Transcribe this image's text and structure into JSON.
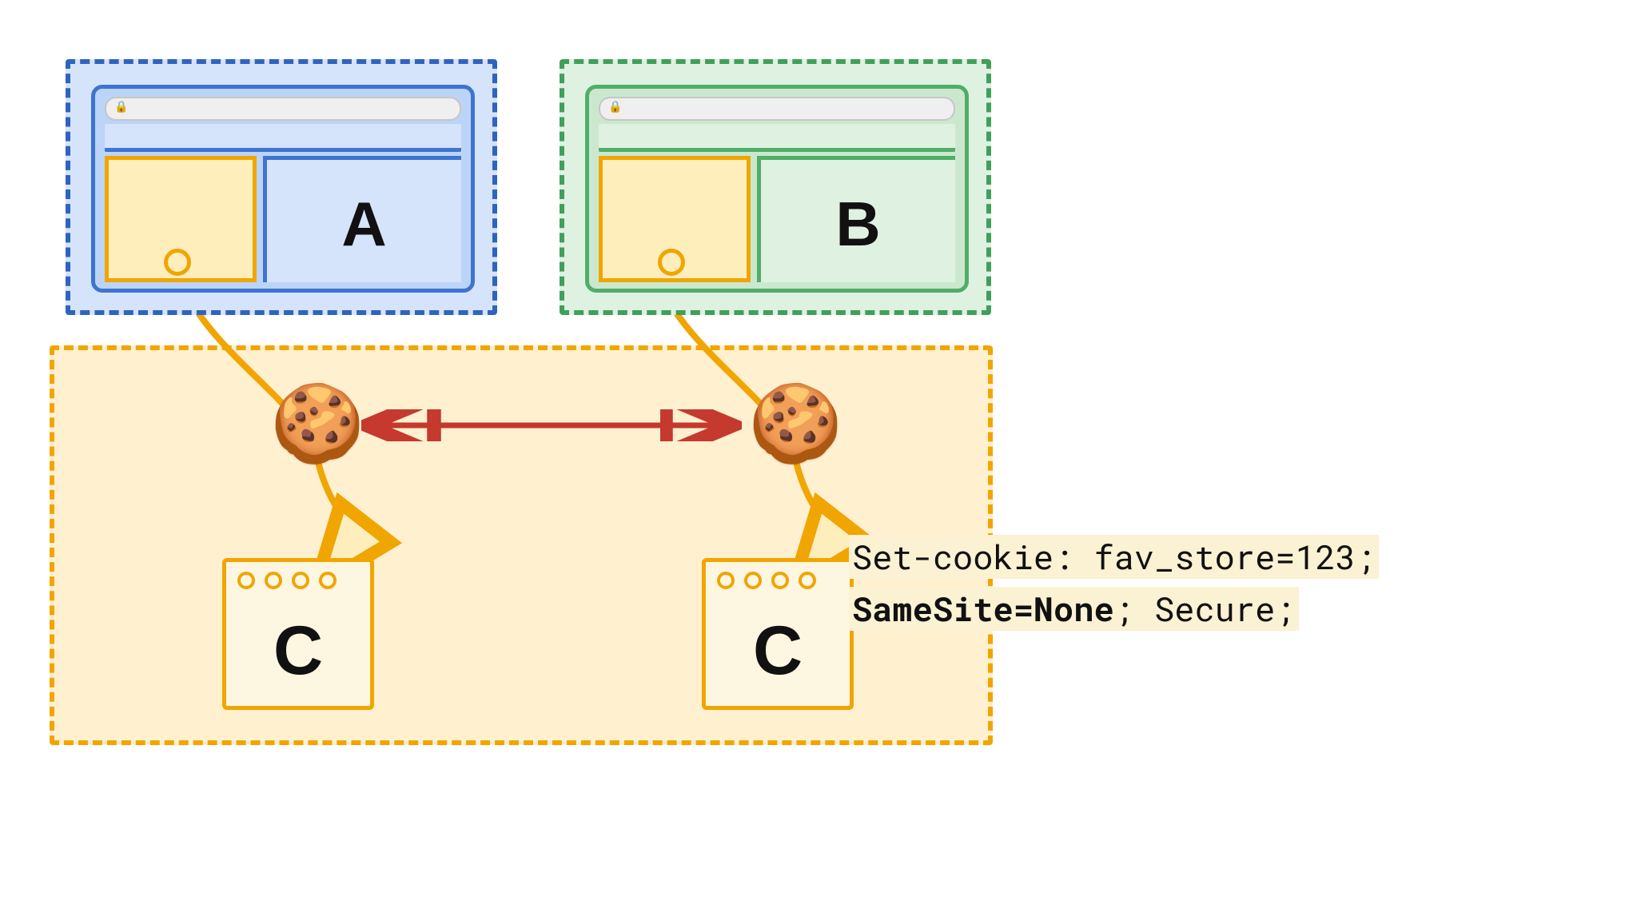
{
  "diagram": {
    "sites": {
      "a": {
        "label": "A",
        "color": "#2f63bf"
      },
      "b": {
        "label": "B",
        "color": "#3fa05a"
      }
    },
    "shared": {
      "label": "C",
      "color": "#f1a500"
    },
    "cookie_header": {
      "line1_prefix": "Set-cookie: fav_store=123;",
      "line2_bold": "SameSite=None",
      "line2_rest": "; Secure;"
    },
    "arrow_color": "#c5392f",
    "connector_color": "#f1a500",
    "icons": {
      "cookie": "🍪",
      "lock": "🔒"
    }
  }
}
